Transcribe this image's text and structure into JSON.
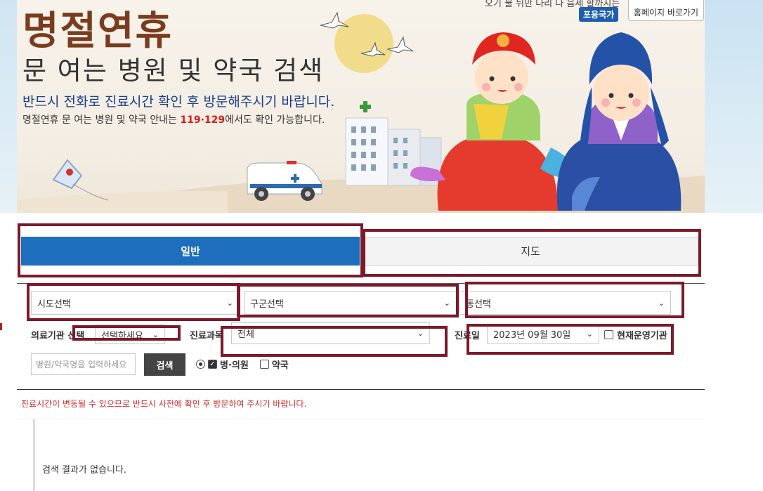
{
  "banner": {
    "title": "명절연휴",
    "subtitle": "문 여는 병원 및 약국 검색",
    "notice": "반드시 전화로 진료시간 확인 후 방문해주시기 바랍니다.",
    "info_prefix": "명절연휴 문 여는 병원 및 약국 안내는 ",
    "info_numbers": "119·129",
    "info_suffix": "에서도 확인 가능합니다.",
    "top_text": "오기 불 뒤만 나리 나 음세 할까지는",
    "gov_badge": "포용국가",
    "home_button": "홈페이지 바로가기"
  },
  "tabs": {
    "general": "일반",
    "map": "지도"
  },
  "filters": {
    "sido": "시도선택",
    "gugun": "구군선택",
    "dong": "동선택",
    "institution_label": "의료기관 선택",
    "institution_value": "선택하세요",
    "department_label": "진료과목",
    "department_value": "전체",
    "date_label": "진료일",
    "date_value": "2023년 09월 30일",
    "operating_label": "현재운영기관"
  },
  "search": {
    "placeholder": "병원/약국명을 입력하세요",
    "button": "검색",
    "hospital_label": "병·의원",
    "pharmacy_label": "약국"
  },
  "warning": "진료시간이 변동될 수 있으므로 반드시 사전에 확인 후 방문하여 주시기 바랍니다.",
  "results": {
    "empty_message": "검색 결과가 없습니다."
  },
  "colors": {
    "tab_active": "#1d6fbd",
    "highlight": "#7b1a2a",
    "title_brown": "#7a3c1e",
    "notice_blue": "#1b3d8a",
    "warning_red": "#d02828"
  }
}
